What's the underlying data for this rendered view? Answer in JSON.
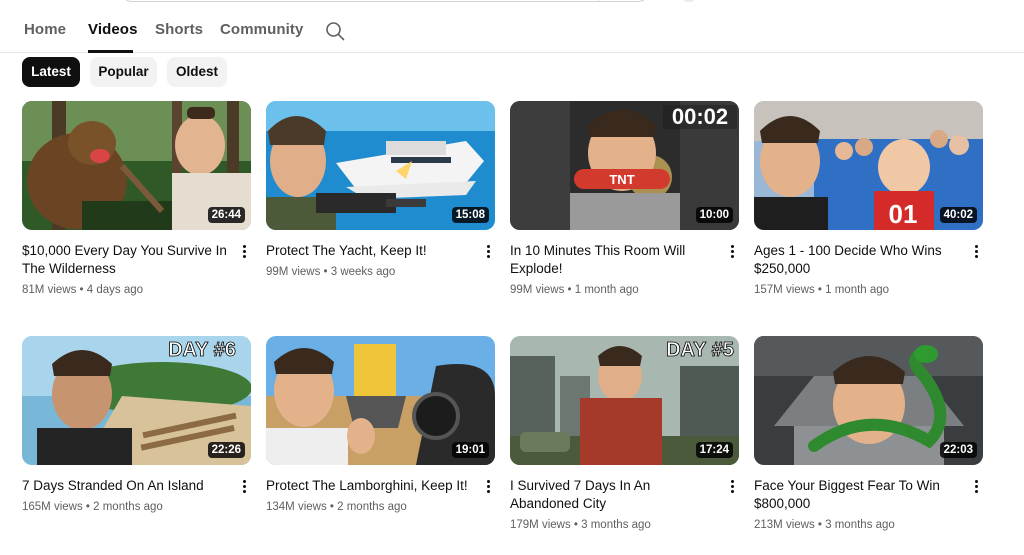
{
  "tabs": [
    {
      "label": "Home"
    },
    {
      "label": "Videos"
    },
    {
      "label": "Shorts"
    },
    {
      "label": "Community"
    }
  ],
  "active_tab": "Videos",
  "icons": {
    "search": "search-icon",
    "more": "more-vert-icon"
  },
  "filters": [
    {
      "label": "Latest",
      "selected": true
    },
    {
      "label": "Popular",
      "selected": false
    },
    {
      "label": "Oldest",
      "selected": false
    }
  ],
  "videos": [
    {
      "title": "$10,000 Every Day You Survive In The Wilderness",
      "views": "81M views",
      "age": "4 days ago",
      "duration": "26:44"
    },
    {
      "title": "Protect The Yacht, Keep It!",
      "views": "99M views",
      "age": "3 weeks ago",
      "duration": "15:08"
    },
    {
      "title": "In 10 Minutes This Room Will Explode!",
      "views": "99M views",
      "age": "1 month ago",
      "duration": "10:00",
      "overlay_text": "00:02",
      "prop_text": "TNT"
    },
    {
      "title": "Ages 1 - 100 Decide Who Wins $250,000",
      "views": "157M views",
      "age": "1 month ago",
      "duration": "40:02",
      "overlay_text": "01"
    },
    {
      "title": "7 Days Stranded On An Island",
      "views": "165M views",
      "age": "2 months ago",
      "duration": "22:26",
      "overlay_text": "DAY #6"
    },
    {
      "title": "Protect The Lamborghini, Keep It!",
      "views": "134M views",
      "age": "2 months ago",
      "duration": "19:01"
    },
    {
      "title": "I Survived 7 Days In An Abandoned City",
      "views": "179M views",
      "age": "3 months ago",
      "duration": "17:24",
      "overlay_text": "DAY #5"
    },
    {
      "title": "Face Your Biggest Fear To Win $800,000",
      "views": "213M views",
      "age": "3 months ago",
      "duration": "22:03"
    }
  ],
  "colors": {
    "text": "#0f0f0f",
    "secondary": "#606060",
    "chip": "#f2f2f2",
    "chip_selected": "#0f0f0f"
  }
}
